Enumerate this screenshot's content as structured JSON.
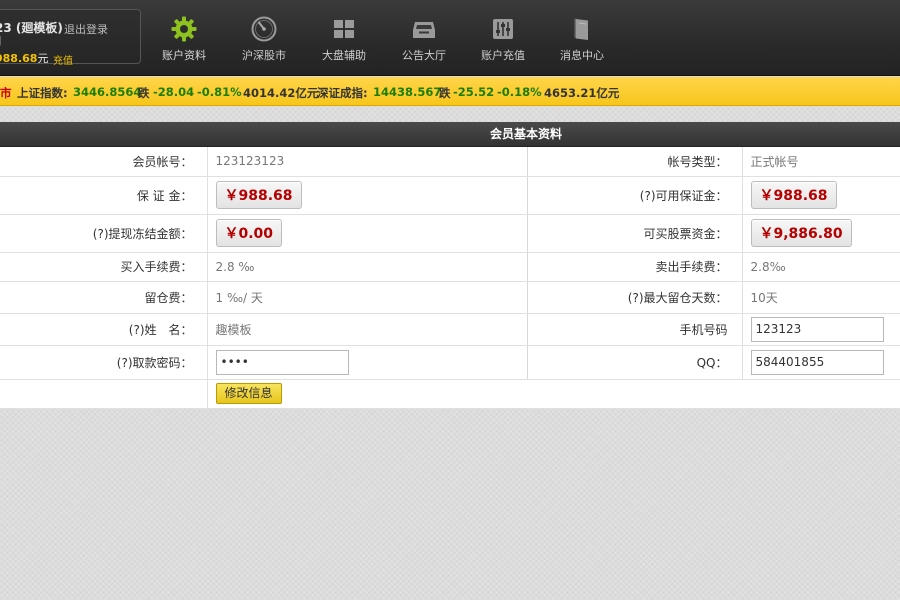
{
  "header": {
    "user_name": "23 (廻模板)",
    "logout_label": "退出登录",
    "bracket": "]",
    "balance_value": "988.68",
    "balance_unit": "元",
    "recharge_label": "充值"
  },
  "nav": [
    {
      "label": "账户资料",
      "icon": "gear-icon"
    },
    {
      "label": "沪深股市",
      "icon": "gauge-icon"
    },
    {
      "label": "大盘辅助",
      "icon": "grid-icon"
    },
    {
      "label": "公告大厅",
      "icon": "inbox-icon"
    },
    {
      "label": "账户充值",
      "icon": "sliders-icon"
    },
    {
      "label": "消息中心",
      "icon": "book-icon"
    }
  ],
  "ticker": {
    "market_tag": "市",
    "sh_label": "上证指数:",
    "sh_value": "3446.8564",
    "sh_dir": "跌",
    "sh_change": "-28.04",
    "sh_pct": "-0.81%",
    "sh_amount": "4014.42亿元",
    "sz_label": "深证成指:",
    "sz_value": "14438.567",
    "sz_dir": "跌",
    "sz_change": "-25.52",
    "sz_pct": "-0.18%",
    "sz_amount": "4653.21亿元"
  },
  "panel": {
    "title": "会员基本资料",
    "account_label": "会员帐号：",
    "account_value": "123123123",
    "account_type_label": "帐号类型：",
    "account_type_value": "正式帐号",
    "deposit_label": "保 证 金：",
    "deposit_value": "￥988.68",
    "avail_deposit_label": "(?)可用保证金：",
    "avail_deposit_value": "￥988.68",
    "frozen_label": "(?)提现冻结金额：",
    "frozen_value": "￥0.00",
    "stock_funds_label": "可买股票资金：",
    "stock_funds_value": "￥9,886.80",
    "buy_fee_label": "买入手续费：",
    "buy_fee_value": "2.8 ‰",
    "sell_fee_label": "卖出手续费：",
    "sell_fee_value": "2.8‰",
    "hold_fee_label": "留仓费：",
    "hold_fee_value": "1 ‰/ 天",
    "max_hold_label": "(?)最大留仓天数：",
    "max_hold_value": "10天",
    "name_label": "(?)姓　名：",
    "name_value": "趣模板",
    "phone_label": "手机号码",
    "phone_value": "123123",
    "password_label": "(?)取款密码：",
    "password_value": "abcd",
    "qq_label": "QQ：",
    "qq_value": "584401855",
    "submit_label": "修改信息"
  }
}
